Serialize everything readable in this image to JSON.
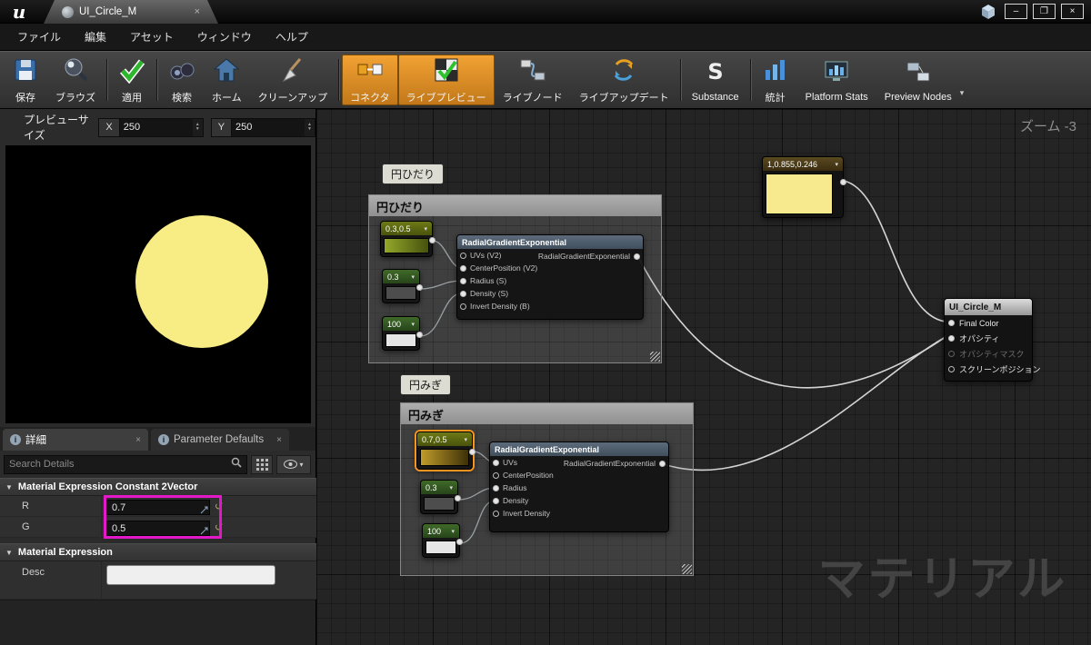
{
  "glyphs": {
    "caret_down": "▾",
    "close": "×",
    "minimize": "–",
    "maximize": "❐",
    "spin_up": "▲",
    "spin_down": "▼",
    "tri_down": "▼",
    "reset": "↺",
    "info": "i"
  },
  "titlebar": {
    "tab_label": "UI_Circle_M"
  },
  "menubar": {
    "items": [
      "ファイル",
      "編集",
      "アセット",
      "ウィンドウ",
      "ヘルプ"
    ]
  },
  "toolbar": {
    "buttons": [
      {
        "label": "保存"
      },
      {
        "label": "ブラウズ"
      },
      {
        "label": "適用"
      },
      {
        "label": "検索"
      },
      {
        "label": "ホーム"
      },
      {
        "label": "クリーンアップ"
      },
      {
        "label": "コネクタ",
        "active": true
      },
      {
        "label": "ライブプレビュー",
        "active": true
      },
      {
        "label": "ライブノード"
      },
      {
        "label": "ライブアップデート"
      },
      {
        "label": "Substance"
      },
      {
        "label": "統計"
      },
      {
        "label": "Platform Stats"
      },
      {
        "label": "Preview Nodes"
      }
    ]
  },
  "preview_panel": {
    "size_label": "プレビューサイズ",
    "x_label": "X",
    "x_value": "250",
    "y_label": "Y",
    "y_value": "250",
    "circle_color": "#f8ec85"
  },
  "details_panel": {
    "tabs": [
      {
        "label": "詳細"
      },
      {
        "label": "Parameter Defaults"
      }
    ],
    "search_placeholder": "Search Details",
    "section_const2v": "Material Expression Constant 2Vector",
    "r_label": "R",
    "r_value": "0.7",
    "g_label": "G",
    "g_value": "0.5",
    "section_matexp": "Material Expression",
    "desc_label": "Desc",
    "desc_value": "",
    "highlight_color": "#e318c8"
  },
  "graph": {
    "zoom_label": "ズーム -3",
    "watermark": "マテリアル",
    "left_group": {
      "bubble": "円ひだり",
      "header": "円ひだり",
      "const2v": "0.3,0.5",
      "const_radius": "0.3",
      "const_density": "100",
      "radial": {
        "title": "RadialGradientExponential",
        "inputs": [
          {
            "label": "UVs (V2)",
            "connected": false
          },
          {
            "label": "CenterPosition (V2)",
            "connected": true
          },
          {
            "label": "Radius (S)",
            "connected": true
          },
          {
            "label": "Density (S)",
            "connected": true
          },
          {
            "label": "Invert Density (B)",
            "connected": false
          }
        ],
        "output": {
          "label": "RadialGradientExponential",
          "connected": true
        }
      }
    },
    "right_group": {
      "bubble": "円みぎ",
      "header": "円みぎ",
      "const2v": "0.7,0.5",
      "const_radius": "0.3",
      "const_density": "100",
      "radial": {
        "title": "RadialGradientExponential",
        "inputs": [
          {
            "label": "UVs",
            "connected": true
          },
          {
            "label": "CenterPosition",
            "connected": false
          },
          {
            "label": "Radius",
            "connected": true
          },
          {
            "label": "Density",
            "connected": true
          },
          {
            "label": "Invert Density",
            "connected": false
          }
        ],
        "output": {
          "label": "RadialGradientExponential",
          "connected": true
        }
      }
    },
    "color_node": {
      "label": "1,0.855,0.246",
      "color": "#f7ea8e"
    },
    "output_node": {
      "title": "UI_Circle_M",
      "pins": [
        {
          "label": "Final Color",
          "state": "connected"
        },
        {
          "label": "オパシティ",
          "state": "connected"
        },
        {
          "label": "オパシティマスク",
          "state": "disabled"
        },
        {
          "label": "スクリーンポジション",
          "state": "normal"
        }
      ]
    }
  }
}
